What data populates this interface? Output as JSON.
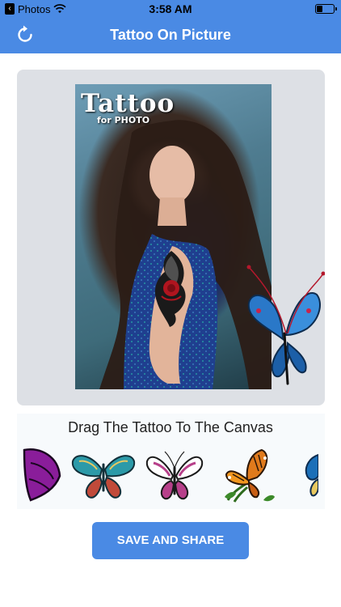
{
  "status_bar": {
    "back_app": "Photos",
    "time": "3:58 AM"
  },
  "nav": {
    "title": "Tattoo On Picture"
  },
  "canvas": {
    "photo_logo_main": "Tattoo",
    "photo_logo_sub": "for PHOTO"
  },
  "tray": {
    "title": "Drag The Tattoo To The Canvas",
    "items": [
      "butterfly-purple-icon",
      "butterfly-teal-icon",
      "butterfly-pink-icon",
      "butterfly-orange-icon",
      "butterfly-blue-icon"
    ]
  },
  "actions": {
    "save_label": "SAVE AND SHARE"
  },
  "colors": {
    "accent": "#4a8ae4",
    "panel": "#dde0e5"
  }
}
